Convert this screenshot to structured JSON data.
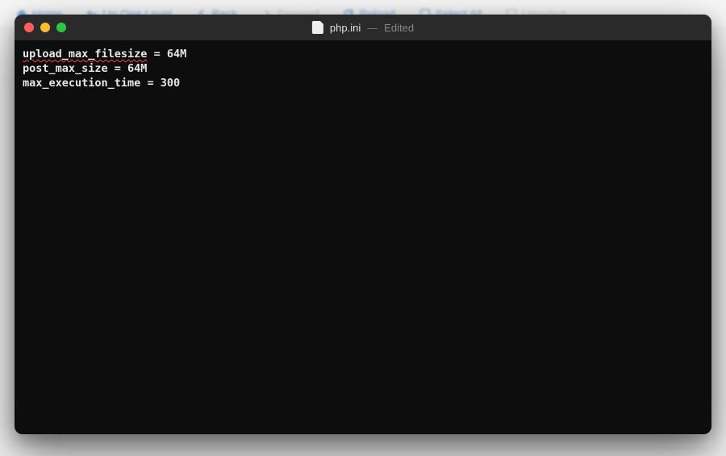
{
  "background_toolbar": {
    "items": [
      {
        "icon": "home-icon",
        "label": "Home",
        "disabled": false
      },
      {
        "icon": "up-icon",
        "label": "Up One Level",
        "disabled": false
      },
      {
        "icon": "back-icon",
        "label": "Back",
        "disabled": false
      },
      {
        "icon": "forward-icon",
        "label": "Forward",
        "disabled": true
      },
      {
        "icon": "reload-icon",
        "label": "Reload",
        "disabled": false
      },
      {
        "icon": "select-all-icon",
        "label": "Select All",
        "disabled": false
      },
      {
        "icon": "unselect-icon",
        "label": "Unselect",
        "disabled": true
      }
    ]
  },
  "window": {
    "filename": "php.ini",
    "separator": "—",
    "status": "Edited"
  },
  "editor": {
    "lines": [
      {
        "prefix": "upload_max_filesize",
        "rest": " = 64M",
        "spellcheck_prefix": true
      },
      {
        "prefix": "post_max_size",
        "rest": " = 64M",
        "spellcheck_prefix": false
      },
      {
        "prefix": "max_execution_time",
        "rest": " = 300",
        "spellcheck_prefix": false
      }
    ]
  }
}
